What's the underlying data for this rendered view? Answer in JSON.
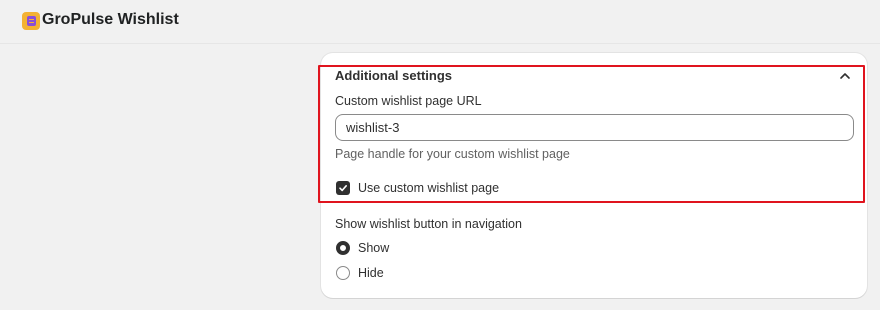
{
  "app": {
    "title": "GroPulse Wishlist",
    "logo_icon": "app-logo-icon",
    "accent": "#f4b233"
  },
  "settings": {
    "section_title": "Additional settings",
    "collapse_icon": "chevron-up-icon",
    "custom_url": {
      "label": "Custom wishlist page URL",
      "value": "wishlist-3",
      "help": "Page handle for your custom wishlist page"
    },
    "use_custom_page": {
      "label": "Use custom wishlist page",
      "checked": true
    },
    "nav_button": {
      "label": "Show wishlist button in navigation",
      "options": [
        {
          "label": "Show",
          "selected": true
        },
        {
          "label": "Hide",
          "selected": false
        }
      ]
    }
  },
  "highlight_color": "#e0141e"
}
